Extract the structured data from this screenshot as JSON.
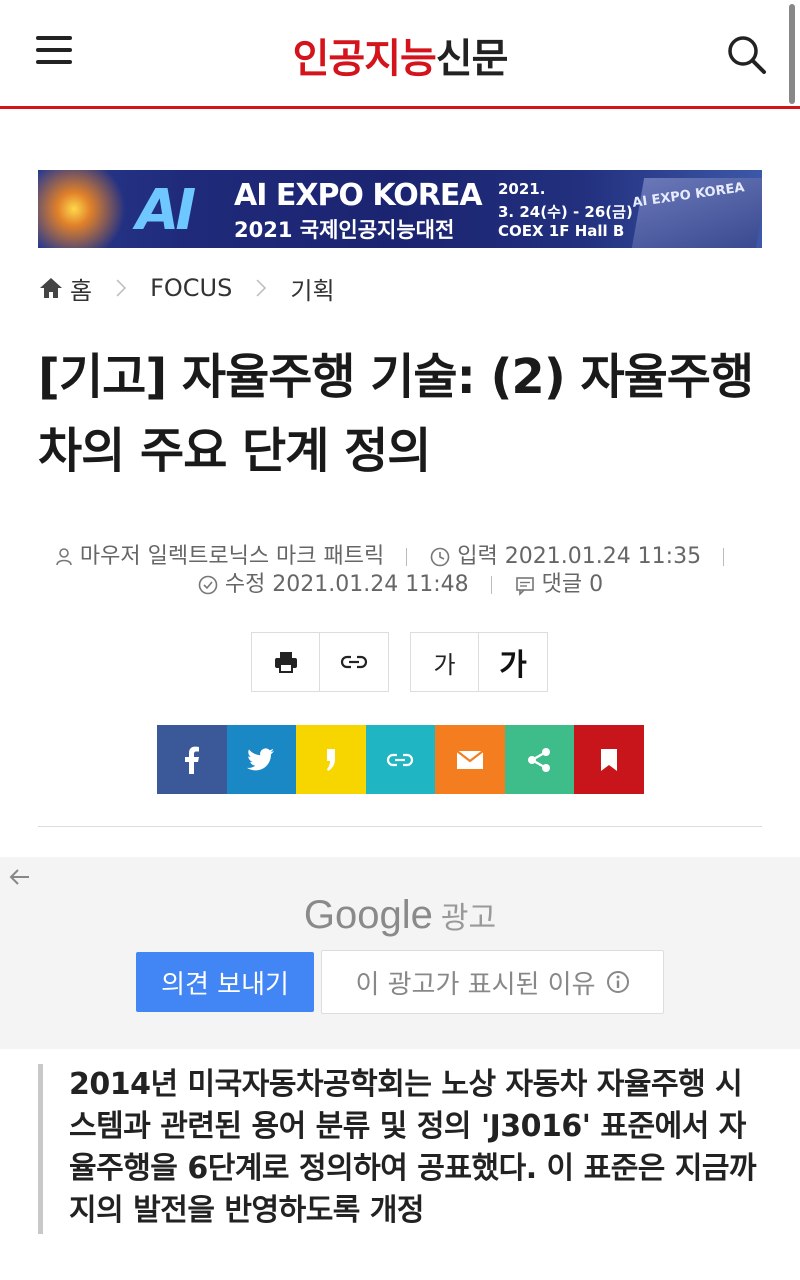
{
  "header": {
    "logo_red": "인공지능",
    "logo_dark": "신문"
  },
  "banner": {
    "ai_mark": "AI",
    "line1": "AI EXPO KOREA",
    "line2": "2021 국제인공지능대전",
    "date_year": "2021.",
    "date_range": "3. 24(수) - 26(금)",
    "venue": "COEX 1F Hall B",
    "building_sign": "AI EXPO KOREA"
  },
  "breadcrumb": {
    "home": "홈",
    "section": "FOCUS",
    "subsection": "기획"
  },
  "article": {
    "title": "[기고] 자율주행 기술: (2) 자율주행차의 주요 단계 정의",
    "author": "마우저 일렉트로닉스 마크 패트릭",
    "published": "입력 2021.01.24 11:35",
    "modified": "수정 2021.01.24 11:48",
    "comments": "댓글 0",
    "summary": "2014년 미국자동차공학회는 노상 자동차 자율주행 시스템과 관련된 용어 분류 및 정의 'J3016' 표준에서 자율주행을 6단계로 정의하여 공표했다. 이 표준은 지금까지의 발전을 반영하도록 개정"
  },
  "tools": {
    "font_small": "가",
    "font_large": "가"
  },
  "share": {
    "colors": [
      "#3b5998",
      "#1b88c6",
      "#f7d600",
      "#1fb5c2",
      "#f47d20",
      "#3ebd8a",
      "#c8151b"
    ]
  },
  "ad": {
    "brand": "Google",
    "label": "광고",
    "feedback": "의견 보내기",
    "why": "이 광고가 표시된 이유"
  },
  "colors": {
    "accent": "#d4141c",
    "feedback_blue": "#4285f4"
  }
}
